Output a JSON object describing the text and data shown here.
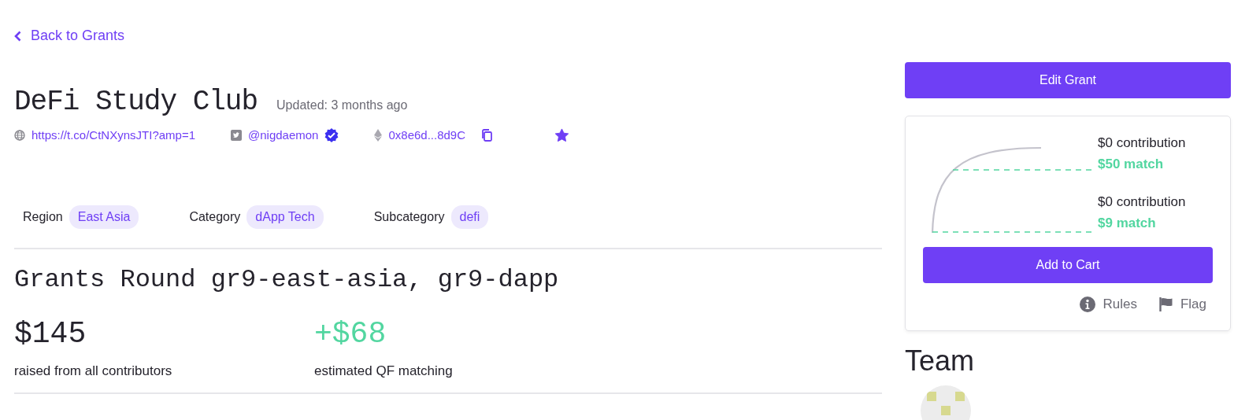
{
  "back_link": {
    "label": "Back to Grants"
  },
  "grant": {
    "title": "DeFi Study Club",
    "updated": "Updated: 3 months ago",
    "starred": true
  },
  "links": [
    {
      "kind": "url",
      "text": "https://t.co/CtNXynsJTI?amp=1"
    },
    {
      "kind": "twitter",
      "text": "@nigdaemon",
      "verified": true
    },
    {
      "kind": "address",
      "text": "0x8e6d...8d9C"
    }
  ],
  "tags": [
    {
      "label": "Region",
      "value": "East Asia"
    },
    {
      "label": "Category",
      "value": "dApp Tech"
    },
    {
      "label": "Subcategory",
      "value": "defi"
    }
  ],
  "round": {
    "title": "Grants Round gr9-east-asia, gr9-dapp"
  },
  "stats": [
    {
      "kind": "raised",
      "amount": "$145",
      "caption": "raised from all contributors"
    },
    {
      "kind": "matching",
      "amount": "+$68",
      "caption": "estimated QF matching"
    }
  ],
  "sidebar": {
    "edit_button": "Edit Grant",
    "estimates": [
      {
        "contribution": "$0 contribution",
        "match": "$50 match"
      },
      {
        "contribution": "$0 contribution",
        "match": "$9 match"
      }
    ],
    "add_to_cart": "Add to Cart",
    "actions": [
      {
        "kind": "rules",
        "label": "Rules"
      },
      {
        "kind": "flag",
        "label": "Flag"
      }
    ]
  },
  "team": {
    "title": "Team"
  }
}
